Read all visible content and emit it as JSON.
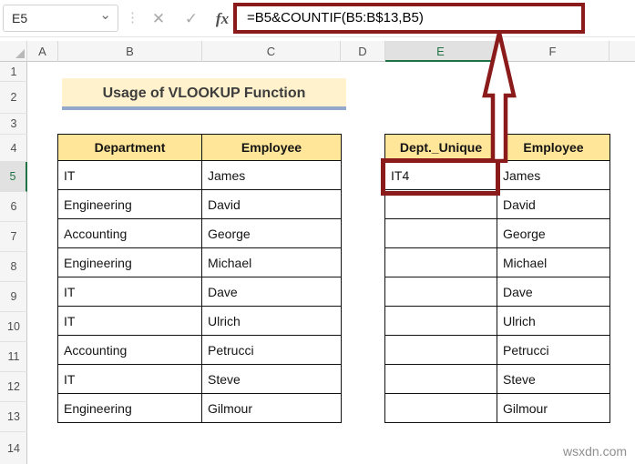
{
  "formula_bar": {
    "name_box_value": "E5",
    "formula": "=B5&COUNTIF(B5:B$13,B5)",
    "icons": {
      "dropdown": "⌄",
      "more_dots": "⋮",
      "cancel": "✕",
      "enter": "✓",
      "function": "fx"
    }
  },
  "sheet": {
    "title": "Usage of VLOOKUP Function",
    "column_labels": [
      "A",
      "B",
      "C",
      "D",
      "E",
      "F"
    ],
    "row_labels": [
      "1",
      "2",
      "3",
      "4",
      "5",
      "6",
      "7",
      "8",
      "9",
      "10",
      "11",
      "12",
      "13",
      "14"
    ],
    "selection": {
      "cell": "E5",
      "column": "E",
      "row": "5",
      "active_value": "IT4"
    },
    "left_table": {
      "headers": [
        "Department",
        "Employee"
      ],
      "rows": [
        [
          "IT",
          "James"
        ],
        [
          "Engineering",
          "David"
        ],
        [
          "Accounting",
          "George"
        ],
        [
          "Engineering",
          "Michael"
        ],
        [
          "IT",
          "Dave"
        ],
        [
          "IT",
          "Ulrich"
        ],
        [
          "Accounting",
          "Petrucci"
        ],
        [
          "IT",
          "Steve"
        ],
        [
          "Engineering",
          "Gilmour"
        ]
      ]
    },
    "right_table": {
      "headers": [
        "Dept._Unique",
        "Employee"
      ],
      "rows": [
        [
          "IT4",
          "James"
        ],
        [
          "",
          "David"
        ],
        [
          "",
          "George"
        ],
        [
          "",
          "Michael"
        ],
        [
          "",
          "Dave"
        ],
        [
          "",
          "Ulrich"
        ],
        [
          "",
          "Petrucci"
        ],
        [
          "",
          "Steve"
        ],
        [
          "",
          "Gilmour"
        ]
      ]
    }
  },
  "annotations": {
    "highlight_color": "#8B1A1A",
    "table_header_fill": "#FFE699",
    "title_fill": "#FFF2CC",
    "title_underline": "#93A9CC",
    "selection_green": "#217346",
    "arrow": "up-arrow from cell E5 to formula bar"
  },
  "watermark": "wsxdn.com"
}
